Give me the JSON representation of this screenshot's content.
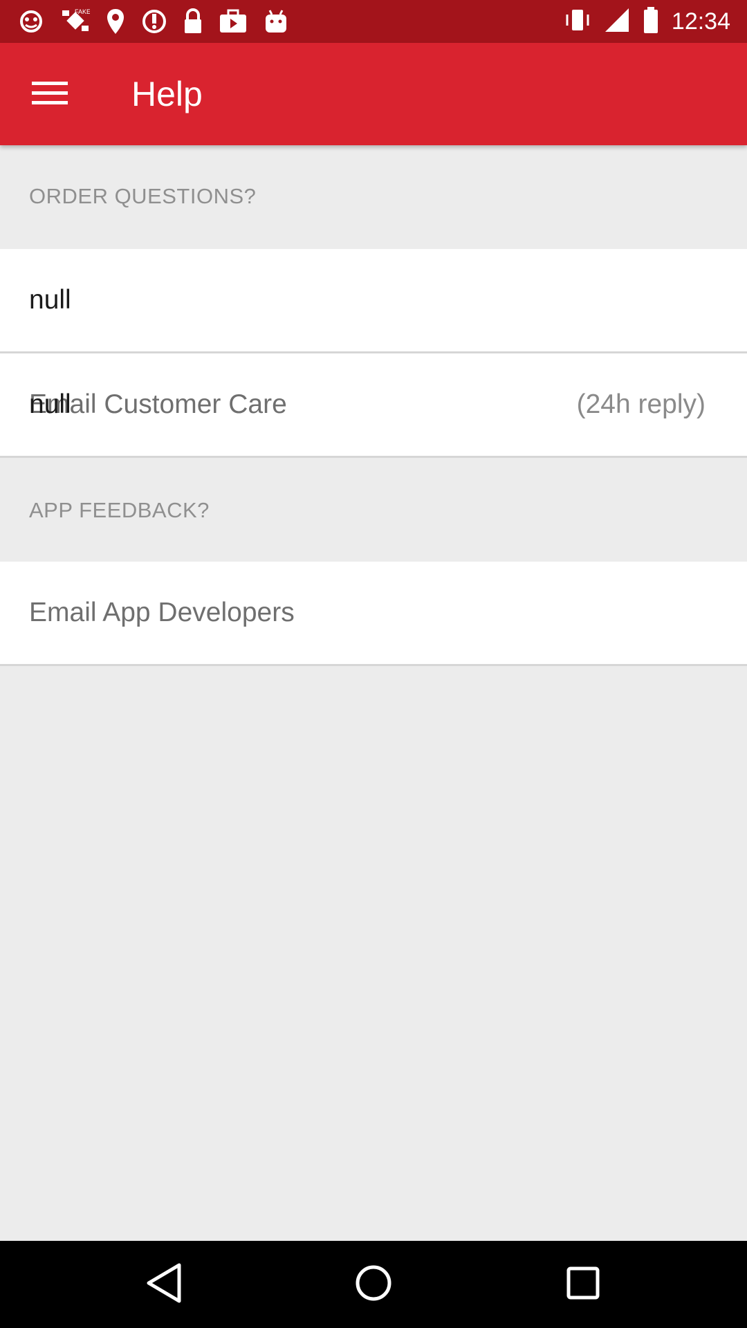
{
  "status_bar": {
    "time": "12:34",
    "left_icons": [
      "notification-icon",
      "fake-gps-icon",
      "location-icon",
      "sync-icon",
      "lock-icon",
      "briefcase-icon",
      "play-store-icon",
      "android-icon"
    ],
    "right_icons": [
      "vibrate-icon",
      "signal-icon",
      "battery-icon"
    ]
  },
  "app_bar": {
    "title": "Help",
    "menu_icon": "hamburger-menu-icon",
    "background": "#d9232f"
  },
  "sections": {
    "order": {
      "header": "ORDER QUESTIONS?",
      "row1": {
        "null_text": "null"
      },
      "row2": {
        "label": "Email Customer Care",
        "note": "(24h reply)",
        "null_text": "null"
      }
    },
    "feedback": {
      "header": "APP FEEDBACK?",
      "row1": {
        "label": "Email App Developers"
      }
    }
  },
  "nav_bar": {
    "buttons": [
      "back-icon",
      "home-icon",
      "recents-icon"
    ]
  },
  "colors": {
    "status_bar": "#a3141b",
    "app_bar": "#d9232f",
    "background": "#ececec"
  }
}
